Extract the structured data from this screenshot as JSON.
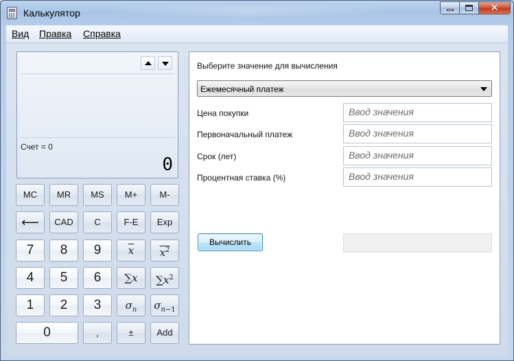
{
  "window": {
    "title": "Калькулятор"
  },
  "menu": {
    "items": [
      "Вид",
      "Правка",
      "Справка"
    ]
  },
  "display": {
    "memory_label": "Счет = 0",
    "value": "0"
  },
  "keypad": {
    "row1": [
      "MC",
      "MR",
      "MS",
      "M+",
      "M-"
    ],
    "row2": [
      "⟵",
      "CAD",
      "C",
      "F-E",
      "Exp"
    ],
    "row3": [
      "7",
      "8",
      "9"
    ],
    "row4": [
      "4",
      "5",
      "6"
    ],
    "row5": [
      "1",
      "2",
      "3"
    ],
    "row6": [
      "0",
      ",",
      "±",
      "Add"
    ]
  },
  "panel": {
    "prompt": "Выберите значение для вычисления",
    "selected_option": "Ежемесячный платеж",
    "fields": [
      {
        "label": "Цена покупки",
        "placeholder": "Ввод значения"
      },
      {
        "label": "Первоначальный платеж",
        "placeholder": "Ввод значения"
      },
      {
        "label": "Срок (лет)",
        "placeholder": "Ввод значения"
      },
      {
        "label": "Процентная ставка (%)",
        "placeholder": "Ввод значения"
      }
    ],
    "calculate_label": "Вычислить",
    "result": ""
  },
  "colors": {
    "accent": "#3c7fb1",
    "title_close": "#c03b1f"
  },
  "icons": [
    "calculator-app-icon",
    "minimize-icon",
    "maximize-icon",
    "close-icon",
    "scroll-up-icon",
    "scroll-down-icon",
    "dropdown-caret-icon",
    "backspace-icon"
  ]
}
